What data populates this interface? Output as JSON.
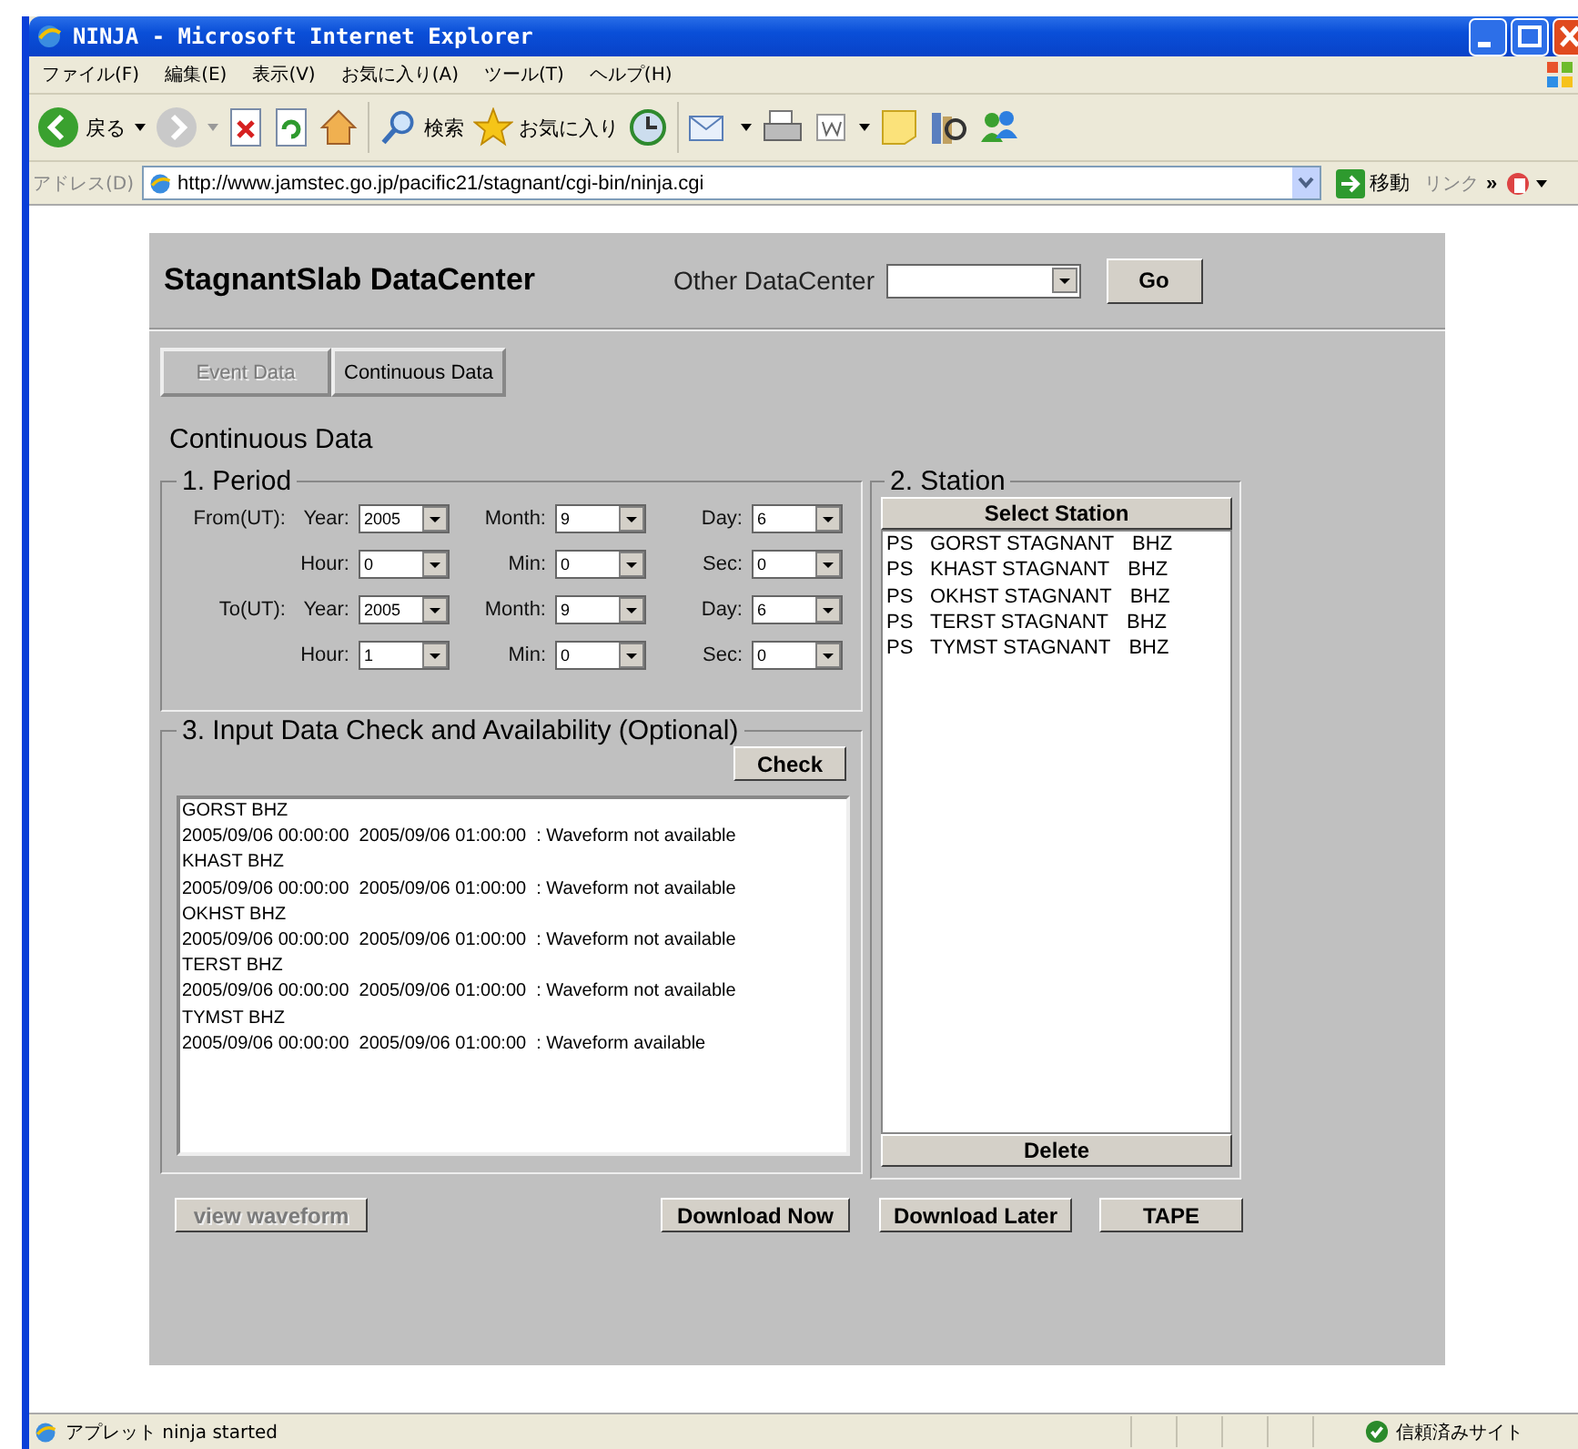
{
  "window": {
    "title": "NINJA - Microsoft Internet Explorer"
  },
  "menu": [
    "ファイル(F)",
    "編集(E)",
    "表示(V)",
    "お気に入り(A)",
    "ツール(T)",
    "ヘルプ(H)"
  ],
  "toolbar": {
    "back_label": "戻る",
    "search_label": "検索",
    "favorites_label": "お気に入り"
  },
  "address_bar": {
    "label": "アドレス(D)",
    "url": "http://www.jamstec.go.jp/pacific21/stagnant/cgi-bin/ninja.cgi",
    "go_label": "移動",
    "links_label": "リンク",
    "more": "»"
  },
  "page": {
    "title": "StagnantSlab DataCenter",
    "other_label": "Other DataCenter",
    "go_button": "Go",
    "tabs": [
      {
        "label": "Event Data",
        "disabled": true
      },
      {
        "label": "Continuous Data",
        "disabled": false
      }
    ],
    "heading": "Continuous Data",
    "period": {
      "legend": "1. Period",
      "rows": [
        {
          "prefix": "From(UT):",
          "fields": [
            {
              "label": "Year:",
              "value": "2005"
            },
            {
              "label": "Month:",
              "value": "9"
            },
            {
              "label": "Day:",
              "value": "6"
            }
          ]
        },
        {
          "fields": [
            {
              "label": "Hour:",
              "value": "0"
            },
            {
              "label": "Min:",
              "value": "0"
            },
            {
              "label": "Sec:",
              "value": "0"
            }
          ]
        },
        {
          "prefix": "To(UT):",
          "fields": [
            {
              "label": "Year:",
              "value": "2005"
            },
            {
              "label": "Month:",
              "value": "9"
            },
            {
              "label": "Day:",
              "value": "6"
            }
          ]
        },
        {
          "fields": [
            {
              "label": "Hour:",
              "value": "1"
            },
            {
              "label": "Min:",
              "value": "0"
            },
            {
              "label": "Sec:",
              "value": "0"
            }
          ]
        }
      ]
    },
    "station": {
      "legend": "2. Station",
      "select_button": "Select Station",
      "delete_button": "Delete",
      "items": [
        {
          "network": "PS",
          "name": "GORST STAGNANT",
          "channel": "BHZ"
        },
        {
          "network": "PS",
          "name": "KHAST STAGNANT",
          "channel": "BHZ"
        },
        {
          "network": "PS",
          "name": "OKHST STAGNANT",
          "channel": "BHZ"
        },
        {
          "network": "PS",
          "name": "TERST STAGNANT",
          "channel": "BHZ"
        },
        {
          "network": "PS",
          "name": "TYMST STAGNANT",
          "channel": "BHZ"
        }
      ]
    },
    "check": {
      "legend": "3. Input Data Check and Availability (Optional)",
      "button": "Check",
      "log": [
        "GORST BHZ",
        "2005/09/06 00:00:00  2005/09/06 01:00:00  : Waveform not available",
        "KHAST BHZ",
        "2005/09/06 00:00:00  2005/09/06 01:00:00  : Waveform not available",
        "OKHST BHZ",
        "2005/09/06 00:00:00  2005/09/06 01:00:00  : Waveform not available",
        "TERST BHZ",
        "2005/09/06 00:00:00  2005/09/06 01:00:00  : Waveform not available",
        "TYMST BHZ",
        "2005/09/06 00:00:00  2005/09/06 01:00:00  : Waveform available"
      ]
    },
    "actions": [
      {
        "label": "view waveform",
        "disabled": true
      },
      {
        "label": "Download Now",
        "disabled": false
      },
      {
        "label": "Download Later",
        "disabled": false
      },
      {
        "label": "TAPE",
        "disabled": false
      }
    ]
  },
  "status_bar": {
    "text": "アプレット ninja started",
    "zone": "信頼済みサイト"
  }
}
